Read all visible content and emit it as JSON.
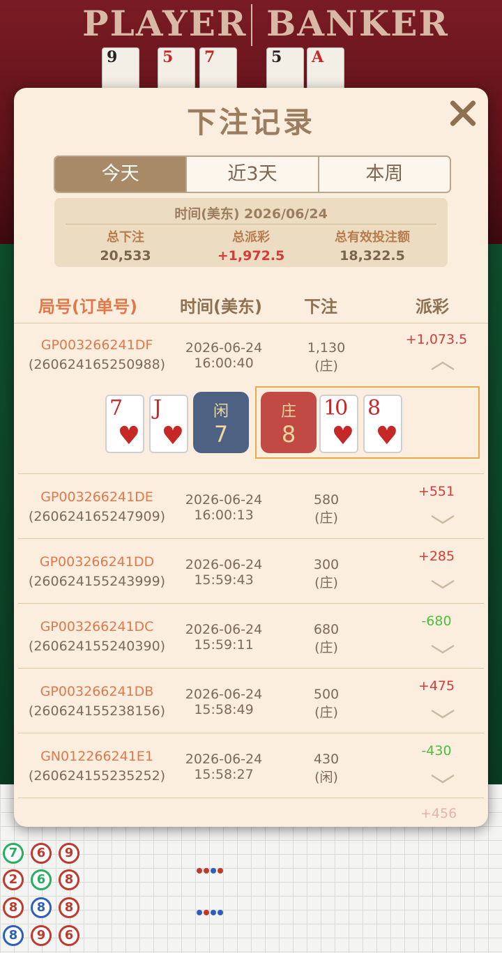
{
  "background": {
    "player_label": "PLAYER",
    "banker_label": "BANKER",
    "card_ranks": [
      "9",
      "5",
      "7",
      "5",
      "A"
    ],
    "road_numbers": [
      "7",
      "6",
      "9",
      "2",
      "6",
      "8",
      "8",
      "8",
      "8",
      "8",
      "9",
      "6"
    ]
  },
  "modal": {
    "title": "下注记录",
    "close_icon": "close-icon",
    "tabs": [
      {
        "label": "今天",
        "active": true
      },
      {
        "label": "近3天",
        "active": false
      },
      {
        "label": "本周",
        "active": false
      }
    ],
    "summary": {
      "date_line": "时间(美东) 2026/06/24",
      "total_bet_label": "总下注",
      "total_bet_value": "20,533",
      "total_payout_label": "总派彩",
      "total_payout_value": "+1,972.5",
      "valid_bet_label": "总有效投注额",
      "valid_bet_value": "18,322.5"
    },
    "columns": {
      "id": "局号(订单号)",
      "time": "时间(美东)",
      "bet": "下注",
      "payout": "派彩"
    },
    "rows": [
      {
        "game_id": "GP003266241DF",
        "order_id": "(260624165250988)",
        "date": "2026-06-24",
        "time": "16:00:40",
        "amount": "1,130",
        "side": "(庄)",
        "payout": "+1,073.5",
        "expanded": true
      },
      {
        "game_id": "GP003266241DE",
        "order_id": "(260624165247909)",
        "date": "2026-06-24",
        "time": "16:00:13",
        "amount": "580",
        "side": "(庄)",
        "payout": "+551",
        "expanded": false
      },
      {
        "game_id": "GP003266241DD",
        "order_id": "(260624155243999)",
        "date": "2026-06-24",
        "time": "15:59:43",
        "amount": "300",
        "side": "(庄)",
        "payout": "+285",
        "expanded": false
      },
      {
        "game_id": "GP003266241DC",
        "order_id": "(260624155240390)",
        "date": "2026-06-24",
        "time": "15:59:11",
        "amount": "680",
        "side": "(庄)",
        "payout": "-680",
        "expanded": false
      },
      {
        "game_id": "GP003266241DB",
        "order_id": "(260624155238156)",
        "date": "2026-06-24",
        "time": "15:58:49",
        "amount": "500",
        "side": "(庄)",
        "payout": "+475",
        "expanded": false
      },
      {
        "game_id": "GN012266241E1",
        "order_id": "(260624155235252)",
        "date": "2026-06-24",
        "time": "15:58:27",
        "amount": "430",
        "side": "(闲)",
        "payout": "-430",
        "expanded": false
      }
    ],
    "peek_row_payout": "+456",
    "result_detail": {
      "player_cards": [
        {
          "rank": "7",
          "suit": "♥"
        },
        {
          "rank": "J",
          "suit": "♥"
        }
      ],
      "player_label": "闲",
      "player_total": "7",
      "banker_label": "庄",
      "banker_total": "8",
      "banker_cards": [
        {
          "rank": "10",
          "suit": "♥"
        },
        {
          "rank": "8",
          "suit": "♥"
        }
      ]
    }
  }
}
